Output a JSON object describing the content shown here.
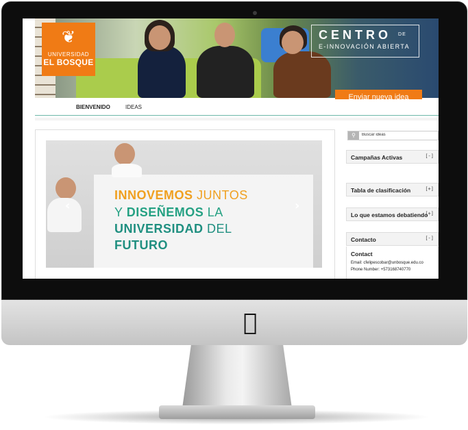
{
  "device": {
    "brand_icon": "apple-icon"
  },
  "header": {
    "logo": {
      "line1": "UNIVERSIDAD",
      "line2": "EL BOSQUE",
      "emblem_icon": "university-emblem-icon"
    },
    "centro": {
      "title": "CENTRO",
      "de": "DE",
      "subtitle": "E-INNOVACIÓN ABIERTA"
    },
    "cta_label": "Enviar nueva idea"
  },
  "nav": {
    "items": [
      {
        "label": "BIENVENIDO",
        "active": true
      },
      {
        "label": "IDEAS",
        "active": false
      }
    ]
  },
  "slider": {
    "line1_bold": "INNOVEMOS",
    "line1_rest": "JUNTOS",
    "line2_pre": "Y",
    "line2_bold": "DISEÑEMOS",
    "line2_rest": "LA",
    "line3_bold": "UNIVERSIDAD",
    "line3_rest": "DEL",
    "line4_bold": "FUTURO",
    "prev_icon": "chevron-left-icon",
    "next_icon": "chevron-right-icon"
  },
  "sidebar": {
    "search": {
      "placeholder": "Buscar ideas",
      "icon": "search-icon"
    },
    "widgets": [
      {
        "title": "Campañas Activas",
        "toggle": "[-]"
      },
      {
        "title": "Tabla de clasificación",
        "toggle": "[+]"
      },
      {
        "title": "Lo que estamos debatiendo",
        "toggle": "[+]"
      },
      {
        "title": "Contacto",
        "toggle": "[-]"
      }
    ],
    "contact": {
      "heading": "Contact",
      "email": "Email: cfelipescobar@unbosque.edu.co",
      "phone": "Phone Number: +573168740770"
    }
  },
  "colors": {
    "brand_orange": "#f07b15",
    "accent_teal": "#1f8f80",
    "headline_orange": "#f0a020"
  }
}
